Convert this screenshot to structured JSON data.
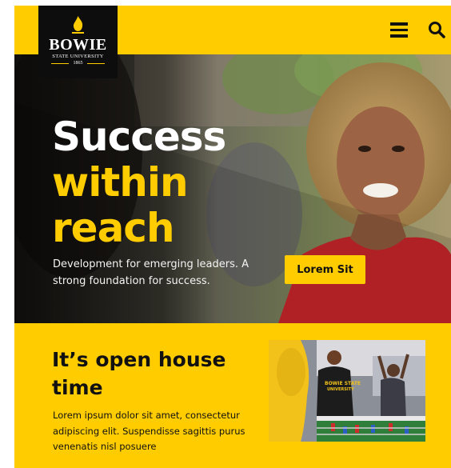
{
  "colors": {
    "brand_gold": "#ffcc00",
    "ink": "#111111",
    "logo_bg": "#0d0d0d"
  },
  "header": {
    "logo": {
      "name": "BOWIE",
      "subtitle": "STATE UNIVERSITY",
      "year": "1865"
    },
    "menu_icon": "hamburger-menu-icon",
    "search_icon": "search-icon"
  },
  "hero": {
    "headline": [
      "Success",
      "within",
      "reach"
    ],
    "description": "Development for emerging leaders. A strong foundation for success.",
    "cta_label": "Lorem Sit"
  },
  "open_house": {
    "title": "It’s open house time",
    "body": "Lorem ipsum dolor sit amet, consectetur adipiscing elit. Suspendisse sagittis purus venenatis nisl posuere",
    "photo_shirt_text": [
      "BOWIE STATE",
      "UNIVERSITY"
    ]
  }
}
